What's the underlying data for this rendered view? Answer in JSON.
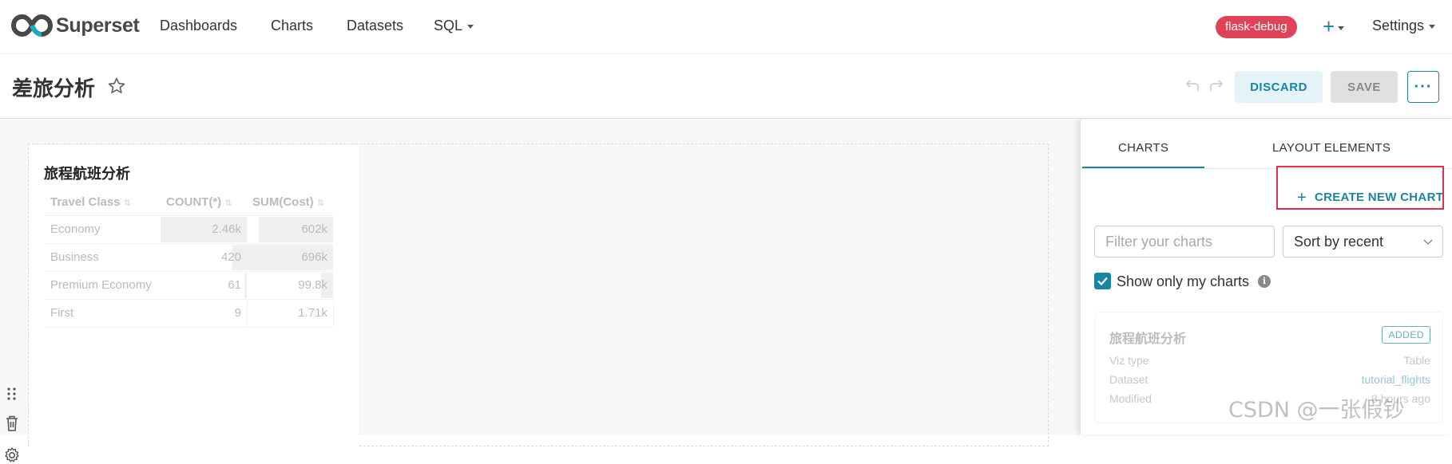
{
  "nav": {
    "brand": "Superset",
    "items": [
      {
        "label": "Dashboards"
      },
      {
        "label": "Charts"
      },
      {
        "label": "Datasets"
      },
      {
        "label": "SQL"
      }
    ],
    "env_badge": "flask-debug",
    "plus_label": "+",
    "settings_label": "Settings"
  },
  "header": {
    "title": "差旅分析",
    "discard_label": "DISCARD",
    "save_label": "SAVE",
    "more_label": "···"
  },
  "chart_card": {
    "title": "旅程航班分析",
    "columns": [
      "Travel Class",
      "COUNT(*)",
      "SUM(Cost)"
    ],
    "rows": [
      {
        "cls": "Economy",
        "count": "2.46k",
        "cost": "602k",
        "count_frac": 1.0,
        "cost_frac": 0.865
      },
      {
        "cls": "Business",
        "count": "420",
        "cost": "696k",
        "count_frac": 0.171,
        "cost_frac": 1.0
      },
      {
        "cls": "Premium Economy",
        "count": "61",
        "cost": "99.8k",
        "count_frac": 0.025,
        "cost_frac": 0.143
      },
      {
        "cls": "First",
        "count": "9",
        "cost": "1.71k",
        "count_frac": 0.004,
        "cost_frac": 0.002
      }
    ]
  },
  "panel": {
    "tabs": [
      "CHARTS",
      "LAYOUT ELEMENTS"
    ],
    "create_label": "CREATE NEW CHART",
    "filter_placeholder": "Filter your charts",
    "sort_value": "Sort by recent",
    "checkbox_label": "Show only my charts",
    "info_glyph": "i",
    "item": {
      "title": "旅程航班分析",
      "badge": "ADDED",
      "viz_type_label": "Viz type",
      "viz_type_value": "Table",
      "dataset_label": "Dataset",
      "dataset_value": "tutorial_flights",
      "modified_label": "Modified",
      "modified_value": "8 hours ago"
    }
  },
  "watermark": "CSDN @一张假钞",
  "colors": {
    "accent": "#1a85a0",
    "badge_red": "#e04355",
    "highlight": "#e52b50"
  }
}
